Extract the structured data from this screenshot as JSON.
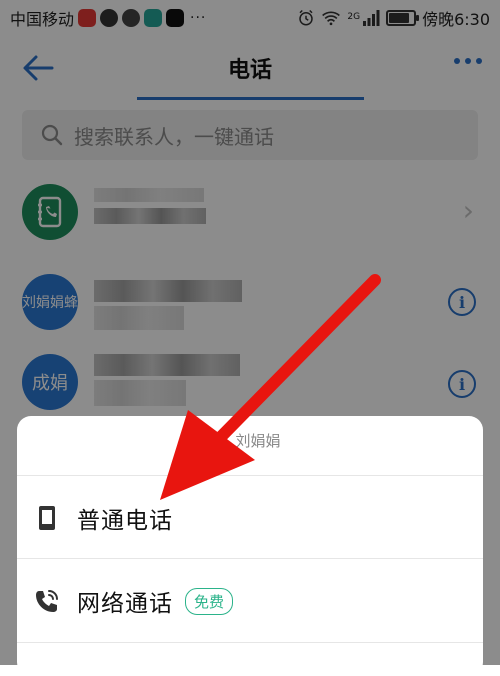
{
  "statusbar": {
    "carrier": "中国移动",
    "dots": "···",
    "network": "2G",
    "time": "傍晚6:30",
    "battery_level": 0.75,
    "app_icon_colors": [
      "#e53935",
      "#333333",
      "#444444",
      "#26a69a",
      "#111111"
    ]
  },
  "header": {
    "title": "电话",
    "back_icon": "arrow-left-icon",
    "more_icon": "more-dots-icon"
  },
  "search": {
    "placeholder": "搜索联系人，一键通话",
    "icon": "search-icon"
  },
  "contacts": [
    {
      "avatar_text": "",
      "avatar_color": "#1e8f5d",
      "avatar_icon": "contacts-book-icon",
      "action": "chevron-right"
    },
    {
      "avatar_text": "刘娟娟蜂",
      "avatar_color": "#2a78d4",
      "action": "info"
    },
    {
      "avatar_text": "成娟",
      "avatar_color": "#2a78d4",
      "action": "info"
    }
  ],
  "chevron_glyph": "›",
  "info_glyph": "i",
  "sheet": {
    "caption": "刘娟娟",
    "options": [
      {
        "label": "普通电话",
        "icon": "phone-device-icon",
        "badge": ""
      },
      {
        "label": "网络通话",
        "icon": "voip-call-icon",
        "badge": "免费"
      }
    ]
  },
  "colors": {
    "accent": "#2a6fc7",
    "free_badge": "#2bb38a",
    "arrow": "#e8150f"
  }
}
